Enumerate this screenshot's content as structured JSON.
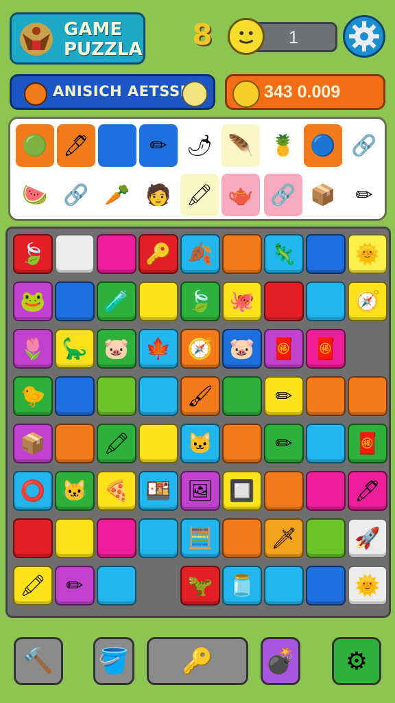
{
  "header": {
    "logo_text": "GAME\nPUZZLA",
    "level": "8",
    "score": "1",
    "team_name": "ANISICH AETSSH",
    "coins": "343 0.009"
  },
  "icons": {
    "logo": "eagle-crest-icon",
    "smiley": "smiley-face-icon",
    "settings": "gear-icon",
    "orb": "orange-orb-icon",
    "coin": "gold-coin-icon"
  },
  "inventory": {
    "row1": [
      {
        "bg": "#f47b1b",
        "glyph": "🟢",
        "name": "green-blob-icon"
      },
      {
        "bg": "#f47b1b",
        "glyph": "🖊",
        "name": "pen-icon"
      },
      {
        "bg": "#1e6fe0",
        "glyph": "",
        "name": "blue-slot"
      },
      {
        "bg": "#1e6fe0",
        "glyph": "✏",
        "name": "yellow-stick-icon"
      },
      {
        "bg": "#ffffff",
        "glyph": "🌶",
        "name": "red-pepper-icon"
      },
      {
        "bg": "#fbf6c5",
        "glyph": "🪶",
        "name": "feather-icon"
      },
      {
        "bg": "#ffffff",
        "glyph": "🍍",
        "name": "pinecone-icon"
      },
      {
        "bg": "#f47b1b",
        "glyph": "🔵",
        "name": "blue-orb-icon"
      },
      {
        "bg": "#ffffff",
        "glyph": "🔗",
        "name": "blue-link-icon"
      }
    ],
    "row2": [
      {
        "bg": "#ffffff",
        "glyph": "🍉",
        "name": "melon-icon"
      },
      {
        "bg": "#ffffff",
        "glyph": "🔗",
        "name": "blue-link-icon"
      },
      {
        "bg": "#ffffff",
        "glyph": "🥕",
        "name": "carrot-icon"
      },
      {
        "bg": "#ffffff",
        "glyph": "🧑",
        "name": "face-icon"
      },
      {
        "bg": "#fbf6c5",
        "glyph": "🖍",
        "name": "crayon-icon"
      },
      {
        "bg": "#f7a9c0",
        "glyph": "🫖",
        "name": "pot-icon"
      },
      {
        "bg": "#f7a9c0",
        "glyph": "🔗",
        "name": "chain-icon"
      },
      {
        "bg": "#ffffff",
        "glyph": "📦",
        "name": "crate-icon"
      },
      {
        "bg": "#ffffff",
        "glyph": "✏",
        "name": "pencil-icon"
      }
    ]
  },
  "board": [
    [
      {
        "c": "#e21f26",
        "g": "🍃"
      },
      {
        "c": "#ececec",
        "g": ""
      },
      {
        "c": "#ee1e9a",
        "g": ""
      },
      {
        "c": "#e21f26",
        "g": "🔑"
      },
      {
        "c": "#21b6ee",
        "g": "🍂"
      },
      {
        "c": "#f47b1b",
        "g": ""
      },
      {
        "c": "#21b6ee",
        "g": "🦎"
      },
      {
        "c": "#1e6fe0",
        "g": ""
      },
      {
        "c": "#fbef4a",
        "g": "🌞"
      }
    ],
    [
      {
        "c": "#c341cf",
        "g": "🐸"
      },
      {
        "c": "#1e6fe0",
        "g": ""
      },
      {
        "c": "#2eb13a",
        "g": "🧪"
      },
      {
        "c": "#fbe21b",
        "g": ""
      },
      {
        "c": "#2eb13a",
        "g": "🍃"
      },
      {
        "c": "#fbe21b",
        "g": "🐙"
      },
      {
        "c": "#e21f26",
        "g": ""
      },
      {
        "c": "#21b6ee",
        "g": ""
      },
      {
        "c": "#fbe21b",
        "g": "🧭"
      }
    ],
    [
      {
        "c": "#c341cf",
        "g": "🌷"
      },
      {
        "c": "#fbe21b",
        "g": "🦕"
      },
      {
        "c": "#2eb13a",
        "g": "🐷"
      },
      {
        "c": "#21b6ee",
        "g": "🍁"
      },
      {
        "c": "#f47b1b",
        "g": "🧭"
      },
      {
        "c": "#1e6fe0",
        "g": "🐷"
      },
      {
        "c": "#c341cf",
        "g": "🧧"
      },
      {
        "c": "#ee1e9a",
        "g": "🧧"
      },
      {
        "c": "#6e6e6e",
        "g": ""
      }
    ],
    [
      {
        "c": "#2eb13a",
        "g": "🐤"
      },
      {
        "c": "#1e6fe0",
        "g": ""
      },
      {
        "c": "#6cc42c",
        "g": ""
      },
      {
        "c": "#21b6ee",
        "g": ""
      },
      {
        "c": "#f47b1b",
        "g": "🖌"
      },
      {
        "c": "#2eb13a",
        "g": ""
      },
      {
        "c": "#fbe21b",
        "g": "✏"
      },
      {
        "c": "#f47b1b",
        "g": ""
      },
      {
        "c": "#f47b1b",
        "g": ""
      }
    ],
    [
      {
        "c": "#c341cf",
        "g": "📦"
      },
      {
        "c": "#f47b1b",
        "g": ""
      },
      {
        "c": "#2eb13a",
        "g": "🖍"
      },
      {
        "c": "#fbe21b",
        "g": ""
      },
      {
        "c": "#21b6ee",
        "g": "🐱"
      },
      {
        "c": "#f47b1b",
        "g": ""
      },
      {
        "c": "#2eb13a",
        "g": "✏"
      },
      {
        "c": "#21b6ee",
        "g": ""
      },
      {
        "c": "#2eb13a",
        "g": "🧧"
      }
    ],
    [
      {
        "c": "#21b6ee",
        "g": "⭕"
      },
      {
        "c": "#2eb13a",
        "g": "🐱"
      },
      {
        "c": "#fbe21b",
        "g": "🍕"
      },
      {
        "c": "#21b6ee",
        "g": "🍱"
      },
      {
        "c": "#c341cf",
        "g": "🖼"
      },
      {
        "c": "#fbe21b",
        "g": "🔲"
      },
      {
        "c": "#f47b1b",
        "g": ""
      },
      {
        "c": "#ee1e9a",
        "g": ""
      },
      {
        "c": "#ee1e9a",
        "g": "🖊"
      }
    ],
    [
      {
        "c": "#e21f26",
        "g": ""
      },
      {
        "c": "#fbe21b",
        "g": ""
      },
      {
        "c": "#ee1e9a",
        "g": ""
      },
      {
        "c": "#21b6ee",
        "g": ""
      },
      {
        "c": "#21b6ee",
        "g": "🧮"
      },
      {
        "c": "#f47b1b",
        "g": ""
      },
      {
        "c": "#f4a21b",
        "g": "🗡"
      },
      {
        "c": "#6cc42c",
        "g": ""
      },
      {
        "c": "#ececec",
        "g": "🚀"
      }
    ],
    [
      {
        "c": "#fbe21b",
        "g": "🖍"
      },
      {
        "c": "#c341cf",
        "g": "✏"
      },
      {
        "c": "#21b6ee",
        "g": ""
      },
      {
        "c": "#6e6e6e",
        "g": ""
      },
      {
        "c": "#e21f26",
        "g": "🦖"
      },
      {
        "c": "#21b6ee",
        "g": "🫙"
      },
      {
        "c": "#21b6ee",
        "g": ""
      },
      {
        "c": "#1e6fe0",
        "g": ""
      },
      {
        "c": "#ececec",
        "g": "🌞"
      }
    ]
  ],
  "toolbar": [
    {
      "name": "hammer-button",
      "glyph": "🔨",
      "bg": "#8b8b8b"
    },
    {
      "name": "bucket-button",
      "glyph": "🪣",
      "bg": "#8b8b8b"
    },
    {
      "name": "key-button",
      "glyph": "🔑",
      "bg": "#8b8b8b"
    },
    {
      "name": "bomb-button",
      "glyph": "💣",
      "bg": "#a855e0"
    },
    {
      "name": "settings-button",
      "glyph": "⚙",
      "bg": "#2eb13a"
    }
  ]
}
